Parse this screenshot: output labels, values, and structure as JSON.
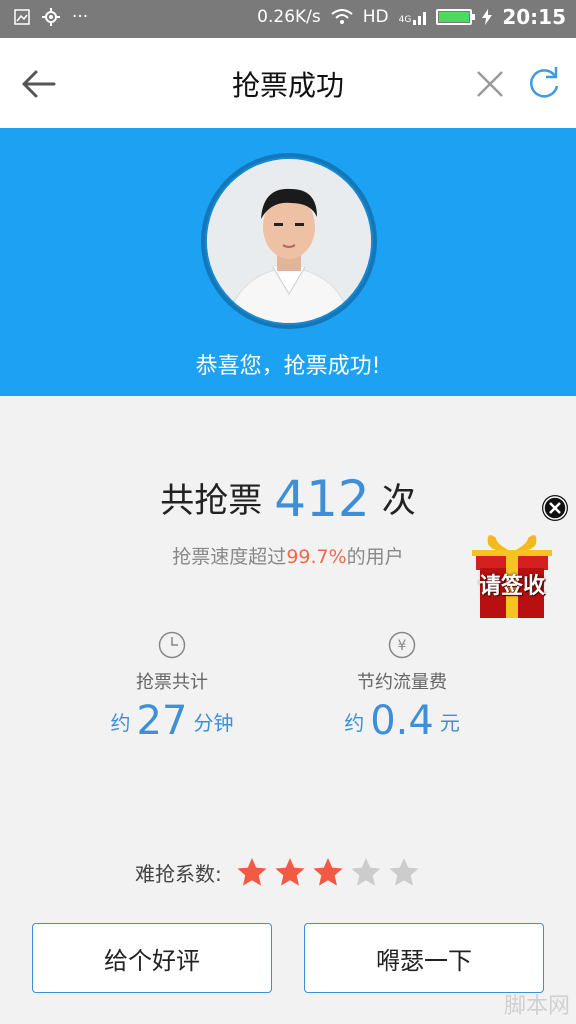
{
  "status_bar": {
    "network_speed": "0.26K/s",
    "hd": "HD",
    "net_type": "4G",
    "time": "20:15",
    "battery_color": "#4cd964"
  },
  "title_bar": {
    "title": "抢票成功",
    "back_icon": "arrow-left-icon",
    "close_icon": "close-icon",
    "refresh_icon": "refresh-icon"
  },
  "banner": {
    "bg_color": "#1da1f2",
    "congrats": "恭喜您，抢票成功!"
  },
  "stats": {
    "count_prefix": "共抢票",
    "count": "412",
    "count_suffix": "次",
    "speed_prefix": "抢票速度超过",
    "speed_pct": "99.7%",
    "speed_suffix": "的用户",
    "time": {
      "icon": "clock-icon",
      "label": "抢票共计",
      "prefix": "约",
      "value": "27",
      "unit": "分钟"
    },
    "saving": {
      "icon": "yen-icon",
      "label": "节约流量费",
      "prefix": "约",
      "value": "0.4",
      "unit": "元"
    }
  },
  "difficulty": {
    "label": "难抢系数:",
    "rating": 3,
    "max": 5,
    "active_color": "#f25a45",
    "inactive_color": "#cccccc"
  },
  "buttons": {
    "rate": "给个好评",
    "share": "嘚瑟一下"
  },
  "promo": {
    "text": "请签收",
    "close_icon": "close-circle-icon"
  },
  "watermark": "脚本网"
}
